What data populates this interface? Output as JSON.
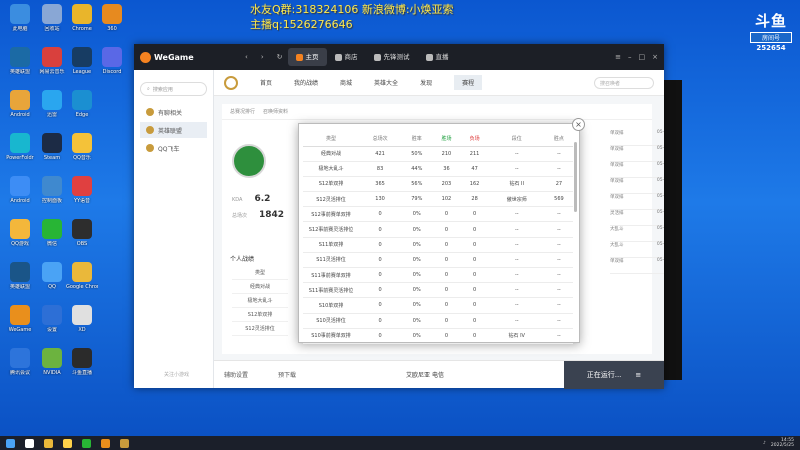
{
  "overlay": {
    "line1": "水友Q群:318324106 新浪微博:小焕亚索",
    "line2": "主播q:1526276646"
  },
  "douyu": {
    "logo": "斗鱼",
    "room_label": "房间号",
    "room_number": "252654"
  },
  "desktop_icons": [
    {
      "label": "此电脑",
      "color": "#3b8de0"
    },
    {
      "label": "英雄联盟",
      "color": "#1b6aa5"
    },
    {
      "label": "Android",
      "color": "#e8a53a"
    },
    {
      "label": "PowerFoldr",
      "color": "#18b7cf"
    },
    {
      "label": "Android",
      "color": "#3d8df5"
    },
    {
      "label": "QQ游戏",
      "color": "#f3b73b"
    },
    {
      "label": "英雄联盟",
      "color": "#1a5588"
    },
    {
      "label": "WeGame",
      "color": "#e98f1c"
    },
    {
      "label": "腾讯会议",
      "color": "#2d74db"
    },
    {
      "label": "回收站",
      "color": "#89a7d5"
    },
    {
      "label": "网易云音乐",
      "color": "#d9403d"
    },
    {
      "label": "迅雷",
      "color": "#2aa6ef"
    },
    {
      "label": "Steam",
      "color": "#1c2b45"
    },
    {
      "label": "控制面板",
      "color": "#3f89cf"
    },
    {
      "label": "微信",
      "color": "#28b535"
    },
    {
      "label": "QQ",
      "color": "#4aa3f5"
    },
    {
      "label": "设置",
      "color": "#2d6fd6"
    },
    {
      "label": "NVIDIA",
      "color": "#6cb33f"
    },
    {
      "label": "Chrome",
      "color": "#e9b52b"
    },
    {
      "label": "League",
      "color": "#173c63"
    },
    {
      "label": "Edge",
      "color": "#1b8fd1"
    },
    {
      "label": "QQ音乐",
      "color": "#f4c239"
    },
    {
      "label": "YY语音",
      "color": "#e04040"
    },
    {
      "label": "OBS",
      "color": "#2d2d2d"
    },
    {
      "label": "Google Chrome",
      "color": "#eab83a"
    },
    {
      "label": "XD",
      "color": "#e0e0e0"
    },
    {
      "label": "斗鱼直播",
      "color": "#2b2b2b"
    },
    {
      "label": "360",
      "color": "#e78a1f"
    },
    {
      "label": "Discord",
      "color": "#5a68e6"
    }
  ],
  "wegame": {
    "brand": "WeGame",
    "tabs": [
      {
        "label": "主页",
        "active": true
      },
      {
        "label": "商店",
        "active": false
      },
      {
        "label": "先锋测试",
        "active": false
      },
      {
        "label": "直播",
        "active": false
      }
    ],
    "search_placeholder": "搜索应用",
    "sidebar": [
      {
        "label": "有聊相关",
        "active": false
      },
      {
        "label": "英雄联盟",
        "active": true
      },
      {
        "label": "QQ飞车",
        "active": false
      }
    ],
    "sidebar_bottom": "关注小游戏",
    "game_nav": [
      "首页",
      "我的战绩",
      "商城",
      "英雄大全",
      "发现",
      "赛程"
    ],
    "game_search_placeholder": "搜召唤者",
    "sub_tabs": [
      "总赛况排行",
      "召唤师资料"
    ],
    "kda_label": "KDA",
    "kda_value": "6.2",
    "win_label": "总场次",
    "win_value": "1842",
    "personal_label": "个人战绩",
    "bg_rows": [
      "类型",
      "经典对战",
      "极地大乱斗",
      "S12单双排",
      "S12灵活排位"
    ],
    "right_list": [
      {
        "name": "单双排",
        "date": "05-23"
      },
      {
        "name": "单双排",
        "date": "05-23"
      },
      {
        "name": "单双排",
        "date": "05-23"
      },
      {
        "name": "单双排",
        "date": "05-23"
      },
      {
        "name": "单双排",
        "date": "05-23"
      },
      {
        "name": "灵活排",
        "date": "05-24"
      },
      {
        "name": "大乱斗",
        "date": "05-24"
      },
      {
        "name": "大乱斗",
        "date": "05-24"
      },
      {
        "name": "单双排",
        "date": "05-24"
      }
    ],
    "bottom": {
      "settings": "辅助设置",
      "download": "预下载",
      "hero": "艾欧尼亚 电信",
      "running": "正在运行..."
    }
  },
  "popup": {
    "headers": [
      "类型",
      "总场次",
      "胜率",
      "胜场",
      "负场",
      "段位",
      "胜点"
    ],
    "rows": [
      [
        "经典对战",
        "421",
        "50%",
        "210",
        "211",
        "--",
        "--"
      ],
      [
        "极地大乱斗",
        "83",
        "44%",
        "36",
        "47",
        "--",
        "--"
      ],
      [
        "S12单双排",
        "365",
        "56%",
        "203",
        "162",
        "钻石 II",
        "27"
      ],
      [
        "S12灵活排位",
        "130",
        "79%",
        "102",
        "28",
        "傲世宗师",
        "569"
      ],
      [
        "S12事前赛单双排",
        "0",
        "0%",
        "0",
        "0",
        "--",
        "--"
      ],
      [
        "S12事前赛灵活排位",
        "0",
        "0%",
        "0",
        "0",
        "--",
        "--"
      ],
      [
        "S11单双排",
        "0",
        "0%",
        "0",
        "0",
        "--",
        "--"
      ],
      [
        "S11灵活排位",
        "0",
        "0%",
        "0",
        "0",
        "--",
        "--"
      ],
      [
        "S11事前赛单双排",
        "0",
        "0%",
        "0",
        "0",
        "--",
        "--"
      ],
      [
        "S11事前赛灵活排位",
        "0",
        "0%",
        "0",
        "0",
        "--",
        "--"
      ],
      [
        "S10单双排",
        "0",
        "0%",
        "0",
        "0",
        "--",
        "--"
      ],
      [
        "S10灵活排位",
        "0",
        "0%",
        "0",
        "0",
        "--",
        "--"
      ],
      [
        "S10事前赛单双排",
        "0",
        "0%",
        "0",
        "0",
        "钻石 IV",
        "--"
      ]
    ]
  },
  "taskbar": {
    "time": "14:55",
    "date": "2022/5/25"
  }
}
